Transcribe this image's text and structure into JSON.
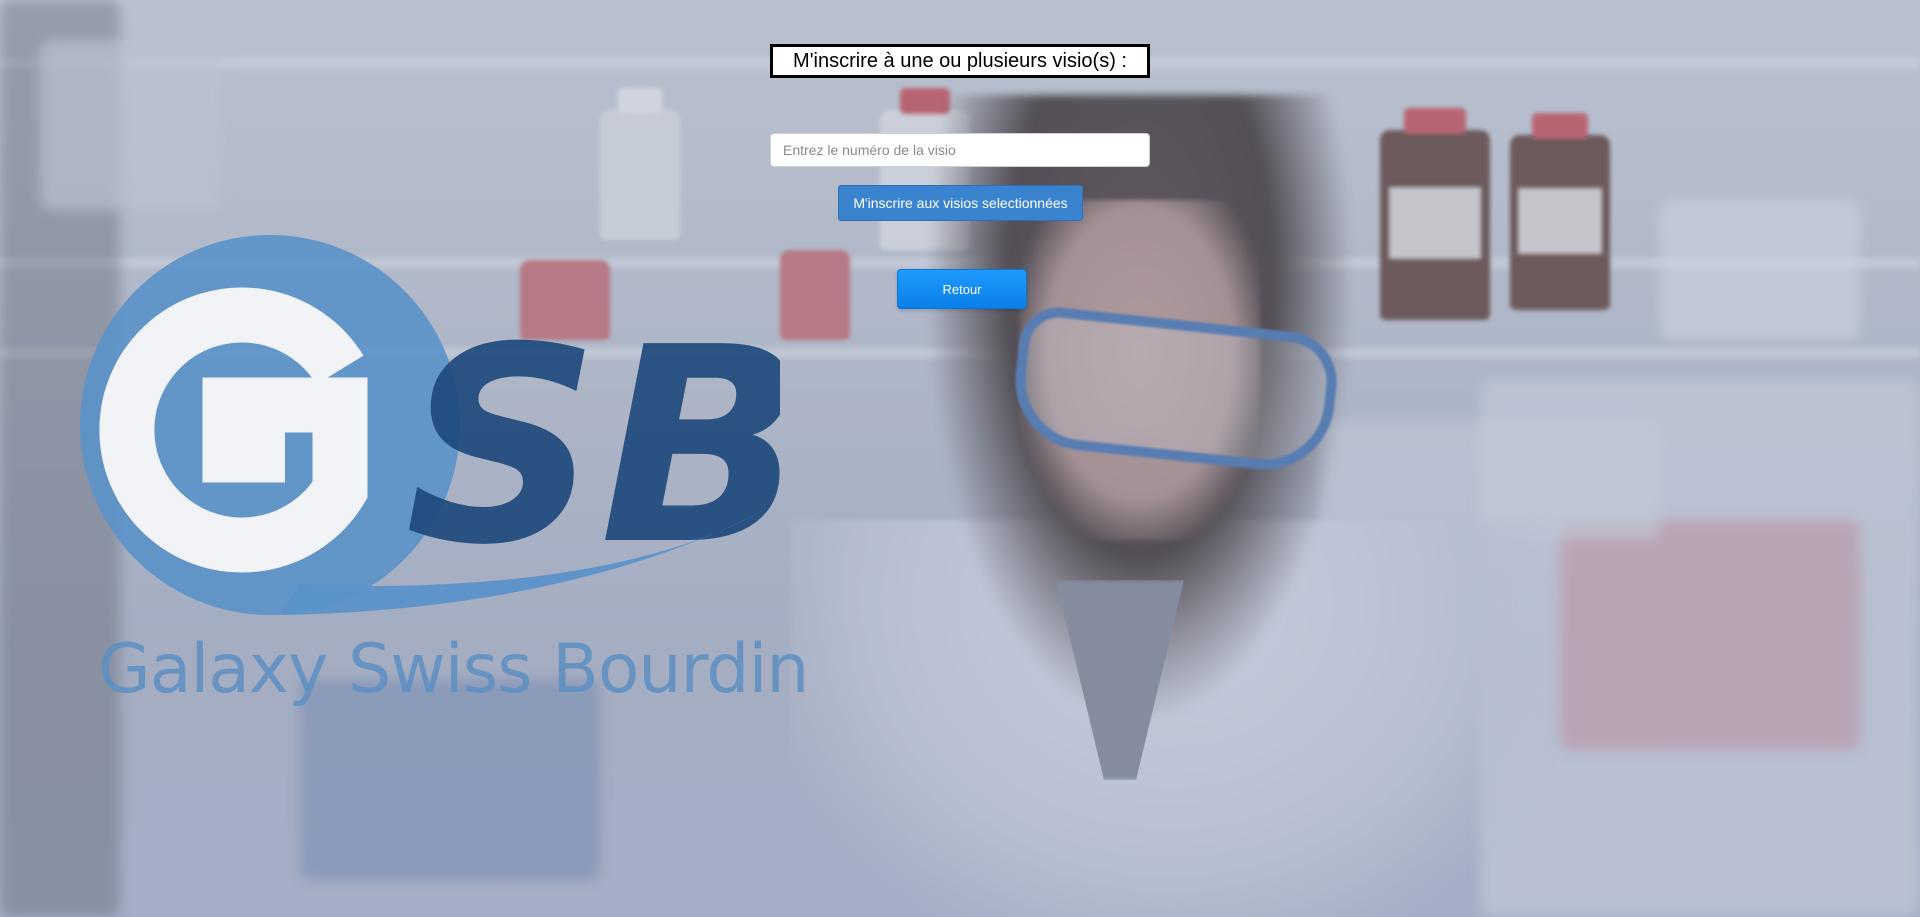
{
  "page": {
    "title": "M'inscrire à une ou plusieurs visio(s) :"
  },
  "form": {
    "visio_input": {
      "placeholder": "Entrez le numéro de la visio",
      "value": ""
    },
    "register_button": "M'inscrire aux visios selectionnées",
    "back_button": "Retour"
  },
  "logo": {
    "letters": "GSB",
    "company_name": "Galaxy Swiss Bourdin"
  },
  "colors": {
    "title_border": "#000000",
    "register_button": "#3a83cf",
    "back_button": "#0a7fe8",
    "logo_light_blue": "#5d8fc4",
    "logo_dark_blue": "#1f4a7d"
  },
  "background": {
    "icon": "laboratory-scientist-photo"
  }
}
